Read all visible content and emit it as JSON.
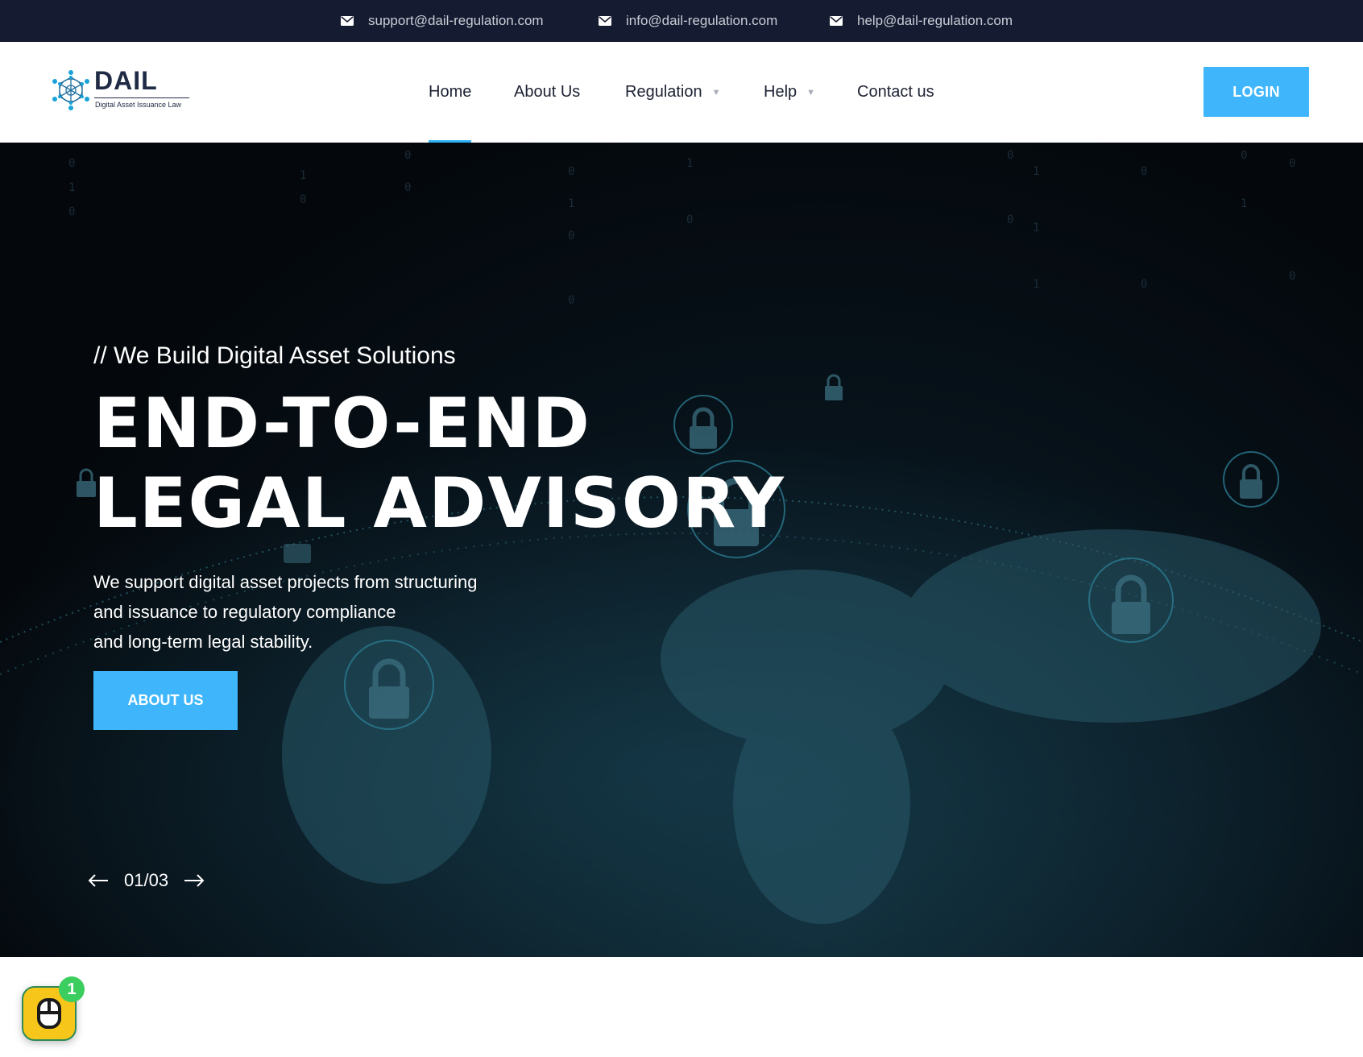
{
  "topbar": {
    "background": "#151b30",
    "contacts": [
      {
        "icon": "envelope-icon",
        "email": "support@dail-regulation.com"
      },
      {
        "icon": "envelope-icon",
        "email": "info@dail-regulation.com"
      },
      {
        "icon": "envelope-icon",
        "email": "help@dail-regulation.com"
      }
    ]
  },
  "header": {
    "logo": {
      "name": "DAIL",
      "tagline": "Digital Asset Issuance Law",
      "icon": "network-globe-icon"
    },
    "nav": [
      {
        "label": "Home",
        "active": true
      },
      {
        "label": "About Us"
      },
      {
        "label": "Regulation",
        "has_dropdown": true
      },
      {
        "label": "Help",
        "has_dropdown": true
      },
      {
        "label": "Contact us"
      }
    ],
    "login_label": "LOGIN"
  },
  "hero": {
    "subtitle": "// We Build Digital Asset Solutions",
    "title_lines": [
      "END-TO-END",
      "LEGAL ADVISORY"
    ],
    "description_lines": [
      "We support digital asset projects from structuring",
      "and issuance to regulatory compliance",
      "and long-term legal stability."
    ],
    "cta_label": "ABOUT US",
    "slider": {
      "counter": "01/03",
      "prev_icon": "arrow-left-icon",
      "next_icon": "arrow-right-icon"
    }
  },
  "widget": {
    "icon": "mouse-icon",
    "badge": "1"
  },
  "colors": {
    "accent": "#3fb6fb",
    "active_underline": "#2fb1f7",
    "badge": "#3ccd5f",
    "widget": "#f7c61a"
  }
}
